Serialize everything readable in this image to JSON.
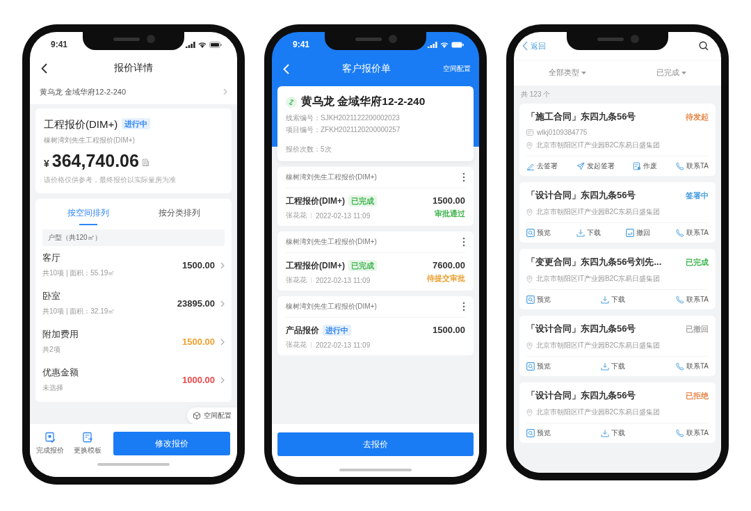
{
  "phone_1": {
    "status_bar": {
      "time": "9:41"
    },
    "title": "报价详情",
    "customer": "黄乌龙 金域华府12-2-240",
    "quote": {
      "title": "工程报价(DIM+)",
      "badge": {
        "label": "进行中",
        "color": "#2f86f0"
      },
      "subtitle": "橡树湾刘先生工程报价(DIM+)",
      "currency": "¥",
      "amount": "364,740.06",
      "note": "该价格仅供参考，最终报价以实际量房为准"
    },
    "tabs": [
      {
        "label": "按空间排列",
        "selected": true
      },
      {
        "label": "按分类排列",
        "selected": false
      }
    ],
    "group_header": "户型（共120㎡）",
    "rows": [
      {
        "name": "客厅",
        "detail": "共10项 | 面积：55.19㎡",
        "amount": "1500.00",
        "color": "#333333"
      },
      {
        "name": "卧室",
        "detail": "共10项 | 面积：32.19㎡",
        "amount": "23895.00",
        "color": "#333333"
      },
      {
        "name": "附加费用",
        "detail": "共2项",
        "amount": "1500.00",
        "color": "#f0a030"
      },
      {
        "name": "优惠金额",
        "detail": "未选择",
        "amount": "1000.00",
        "color": "#e84a4a"
      }
    ],
    "floating_button": "空间配置",
    "toolbar": [
      {
        "label": "完成报价"
      },
      {
        "label": "更换模板"
      }
    ],
    "primary_button": "修改报价"
  },
  "phone_2": {
    "status_bar": {
      "time": "9:41"
    },
    "title": "客户报价单",
    "action": "空间配置",
    "customer": {
      "name": "黄乌龙 金域华府12-2-240",
      "fields": [
        {
          "label": "线索编号：",
          "value": "SJKH2021122200002023"
        },
        {
          "label": "项目编号：",
          "value": "ZFKH2021120200000257"
        },
        {
          "label": "报价次数：",
          "value": "5次"
        }
      ]
    },
    "quotes": [
      {
        "group": "橡树湾刘先生工程报价(DIM+)",
        "title": "工程报价(DIM+)",
        "badge": {
          "label": "已完成",
          "color": "#3cb44b"
        },
        "person": "张花花",
        "date": "2022-02-13 11:09",
        "amount": "1500.00",
        "status": {
          "label": "审批通过",
          "color": "#3cb44b"
        }
      },
      {
        "group": "橡树湾刘先生工程报价(DIM+)",
        "title": "工程报价(DIM+)",
        "badge": {
          "label": "已完成",
          "color": "#3cb44b"
        },
        "person": "张花花",
        "date": "2022-02-13 11:09",
        "amount": "7600.00",
        "status": {
          "label": "待提交审批",
          "color": "#e8a030"
        }
      },
      {
        "group": "橡树湾刘先生工程报价(DIM+)",
        "title": "产品报价",
        "badge": {
          "label": "进行中",
          "color": "#2f86f0"
        },
        "person": "张花花",
        "date": "2022-02-13 11:09",
        "amount": "1500.00"
      }
    ],
    "primary_button": "去报价"
  },
  "phone_3": {
    "back": "返回",
    "filters": [
      {
        "label": "全部类型"
      },
      {
        "label": "已完成"
      }
    ],
    "count": "共 123 个",
    "contracts": [
      {
        "title": "「施工合同」东四九条56号",
        "status": "待发起",
        "color": "#e8874a",
        "code": "wlkj0109384775",
        "address": "北京市朝阳区IT产业园B2C东易日盛集团",
        "actions": [
          {
            "label": "去签署",
            "kind": "sign"
          },
          {
            "label": "发起签署",
            "kind": "send"
          },
          {
            "label": "作废",
            "kind": "void"
          },
          {
            "label": "联系TA",
            "kind": "call"
          }
        ]
      },
      {
        "title": "「设计合同」东四九条56号",
        "status": "签署中",
        "color": "#4a9fe0",
        "address": "北京市朝阳区IT产业园B2C东易日盛集团",
        "actions": [
          {
            "label": "预览",
            "kind": "preview"
          },
          {
            "label": "下载",
            "kind": "download"
          },
          {
            "label": "撤回",
            "kind": "revoke"
          },
          {
            "label": "联系TA",
            "kind": "call"
          }
        ]
      },
      {
        "title": "「变更合同」东四九条56号刘先...",
        "status": "已完成",
        "color": "#3cb44b",
        "address": "北京市朝阳区IT产业园B2C东易日盛集团",
        "actions": [
          {
            "label": "预览",
            "kind": "preview"
          },
          {
            "label": "下载",
            "kind": "download"
          },
          {
            "label": "联系TA",
            "kind": "call"
          }
        ]
      },
      {
        "title": "「设计合同」东四九条56号",
        "status": "已撤回",
        "color": "#aaaaaa",
        "address": "北京市朝阳区IT产业园B2C东易日盛集团",
        "actions": [
          {
            "label": "预览",
            "kind": "preview"
          },
          {
            "label": "下载",
            "kind": "download"
          },
          {
            "label": "联系TA",
            "kind": "call"
          }
        ]
      },
      {
        "title": "「设计合同」东四九条56号",
        "status": "已拒绝",
        "color": "#e8874a",
        "address": "北京市朝阳区IT产业园B2C东易日盛集团",
        "actions": [
          {
            "label": "预览",
            "kind": "preview"
          },
          {
            "label": "下载",
            "kind": "download"
          },
          {
            "label": "联系TA",
            "kind": "call"
          }
        ]
      }
    ]
  }
}
